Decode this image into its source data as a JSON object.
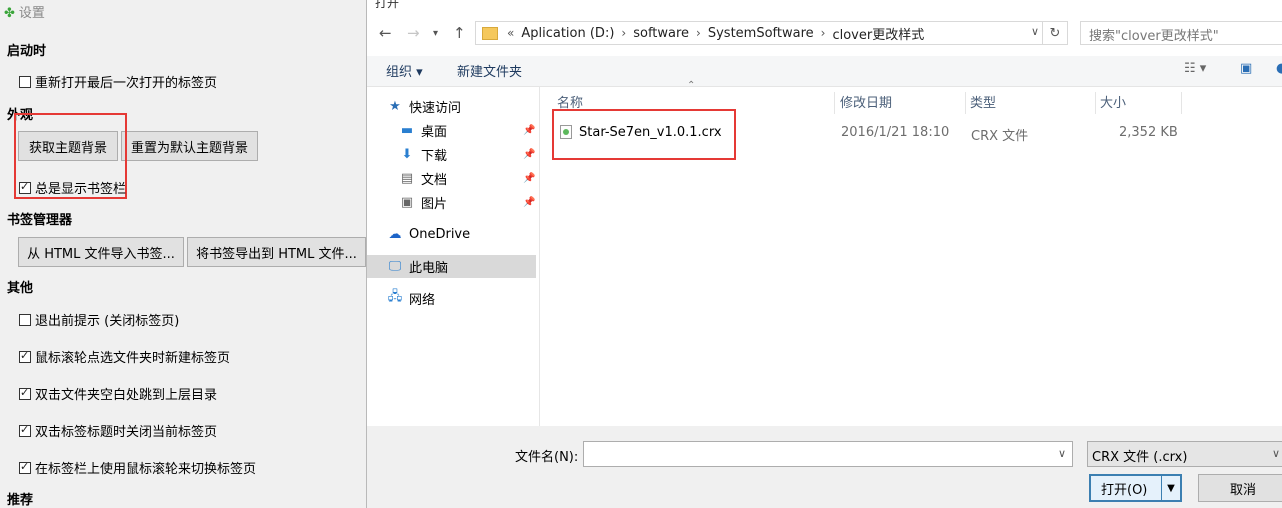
{
  "settings": {
    "title": "设置",
    "sections": {
      "startup": "启动时",
      "appearance": "外观",
      "bookmark_manager": "书签管理器",
      "other": "其他",
      "recommend": "推荐"
    },
    "checks": {
      "reopen_last": {
        "label": "重新打开最后一次打开的标签页",
        "checked": false
      },
      "always_show_bookmark_bar": {
        "label": "总是显示书签栏",
        "checked": true
      },
      "prompt_before_exit": {
        "label": "退出前提示 (关闭标签页)",
        "checked": false
      },
      "wheel_open_folder": {
        "label": "鼠标滚轮点选文件夹时新建标签页",
        "checked": true
      },
      "dblclick_up": {
        "label": "双击文件夹空白处跳到上层目录",
        "checked": true
      },
      "dblclick_close_tab": {
        "label": "双击标签标题时关闭当前标签页",
        "checked": true
      },
      "wheel_switch_tab": {
        "label": "在标签栏上使用鼠标滚轮来切换标签页",
        "checked": true
      }
    },
    "buttons": {
      "get_theme": "获取主题背景",
      "reset_theme": "重置为默认主题背景",
      "import_html": "从 HTML 文件导入书签...",
      "export_html": "将书签导出到 HTML 文件..."
    }
  },
  "dialog": {
    "title": "打开",
    "address": {
      "overflow": "«",
      "segments": [
        "Aplication (D:)",
        "software",
        "SystemSoftware",
        "clover更改样式"
      ]
    },
    "search_placeholder": "搜索\"clover更改样式\"",
    "toolbar": {
      "organize": "组织 ▾",
      "new_folder": "新建文件夹"
    },
    "nav": {
      "quick_access": "快速访问",
      "desktop": "桌面",
      "downloads": "下载",
      "documents": "文档",
      "pictures": "图片",
      "onedrive": "OneDrive",
      "this_pc": "此电脑",
      "network": "网络"
    },
    "columns": {
      "name": "名称",
      "modified": "修改日期",
      "type": "类型",
      "size": "大小"
    },
    "files": [
      {
        "name": "Star-Se7en_v1.0.1.crx",
        "modified": "2016/1/21 18:10",
        "type": "CRX 文件",
        "size": "2,352 KB"
      }
    ],
    "filename_label": "文件名(N):",
    "filename_value": "",
    "filetype": "CRX 文件 (.crx)",
    "open_button": "打开(O)",
    "cancel_button": "取消"
  }
}
